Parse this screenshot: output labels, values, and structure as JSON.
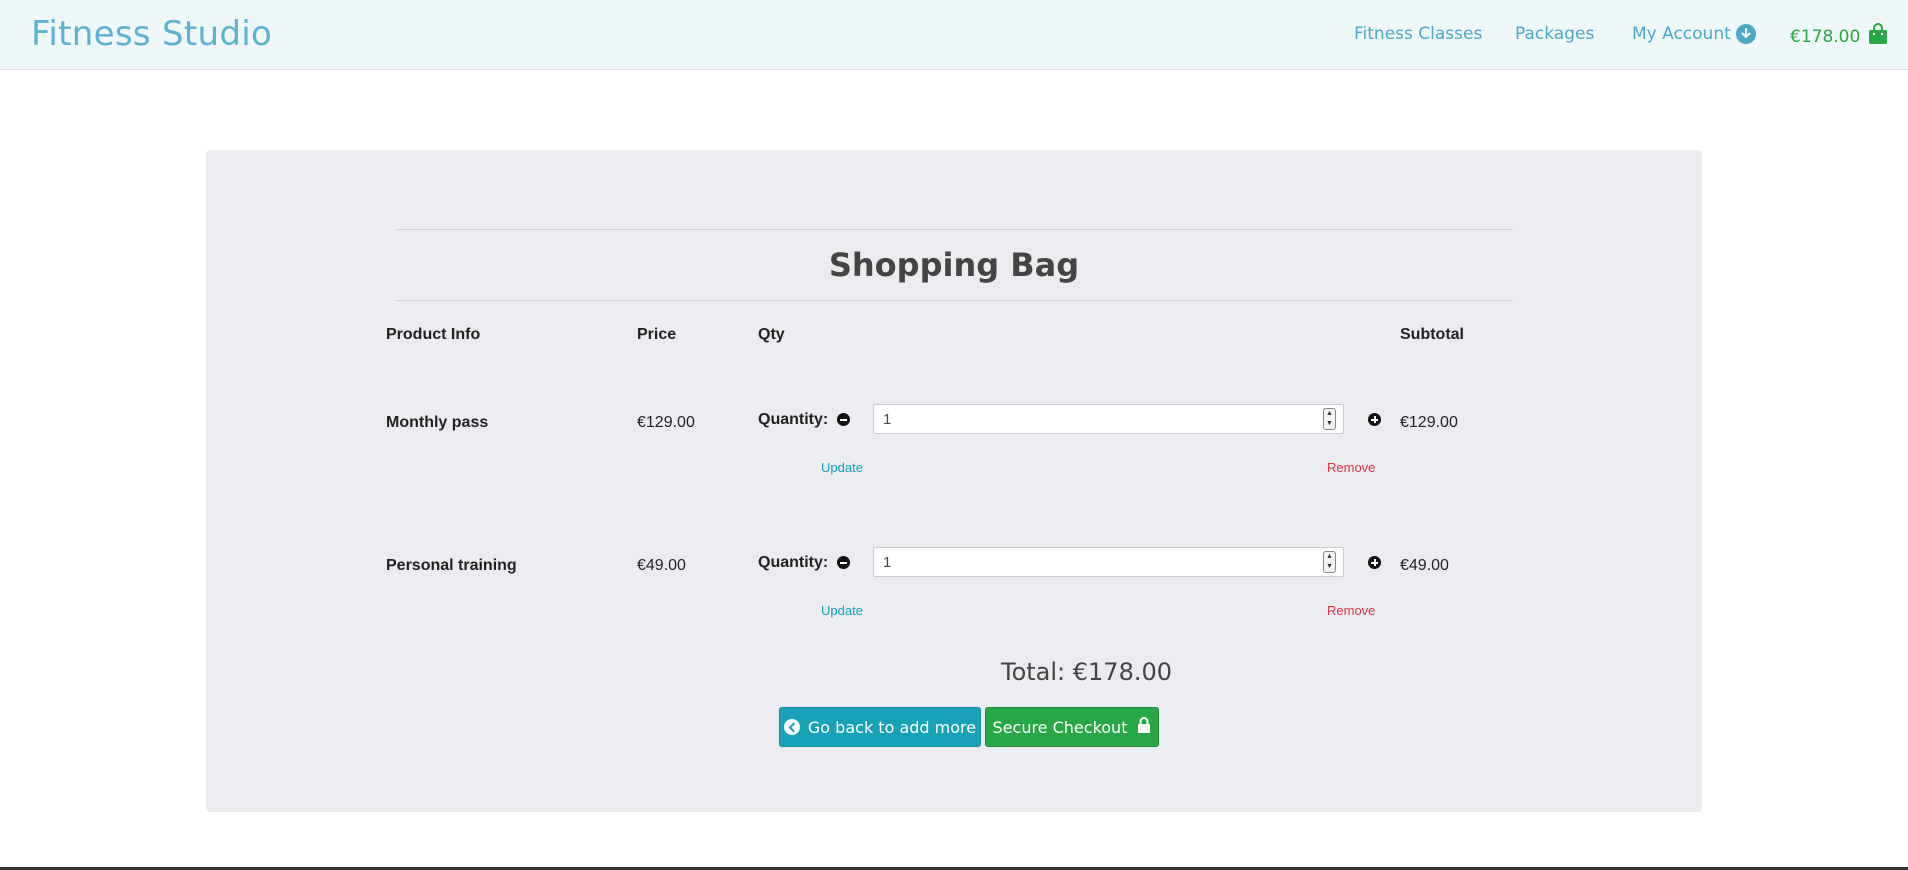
{
  "header": {
    "brand": "Fitness Studio",
    "nav": {
      "classes": "Fitness Classes",
      "packages": "Packages",
      "account": "My Account"
    },
    "bag_total": "€178.00"
  },
  "bag": {
    "title": "Shopping Bag",
    "columns": {
      "product": "Product Info",
      "price": "Price",
      "qty": "Qty",
      "subtotal": "Subtotal"
    },
    "quantity_label": "Quantity:",
    "update_label": "Update",
    "remove_label": "Remove",
    "items": [
      {
        "name": "Monthly pass",
        "price": "€129.00",
        "quantity": "1",
        "subtotal": "€129.00"
      },
      {
        "name": "Personal training",
        "price": "€49.00",
        "quantity": "1",
        "subtotal": "€49.00"
      }
    ],
    "total": "Total: €178.00",
    "back_button": "Go back to add more",
    "checkout_button": "Secure Checkout"
  },
  "colors": {
    "brand": "#5bb3d4",
    "info": "#17a2b8",
    "success": "#28a745",
    "danger": "#dc3545",
    "card_bg": "#ebecf0"
  }
}
